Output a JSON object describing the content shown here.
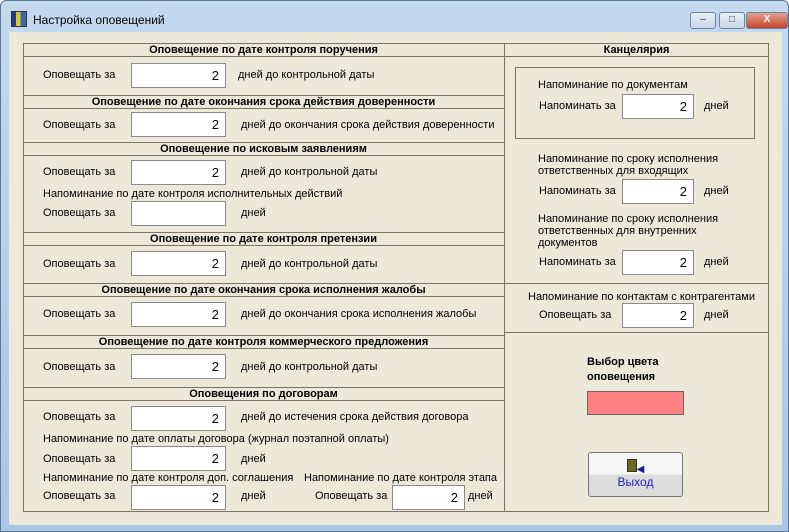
{
  "window": {
    "title": "Настройка оповещений",
    "minimize": "–",
    "maximize": "□",
    "close": "X"
  },
  "left": {
    "s1": {
      "header": "Оповещение по дате контроля поручения",
      "label": "Оповещать за",
      "value": "2",
      "suffix": "дней до контрольной даты"
    },
    "s2": {
      "header": "Оповещение по дате окончания срока действия доверенности",
      "label": "Оповещать за",
      "value": "2",
      "suffix": "дней до окончания срока действия доверенности"
    },
    "s3": {
      "header": "Оповещение по исковым заявлениям",
      "label": "Оповещать за",
      "value": "2",
      "suffix": "дней до контрольной даты",
      "sub": "Напоминание по дате контроля исполнительных действий",
      "label2": "Оповещать за",
      "value2": "",
      "suffix2": "дней"
    },
    "s4": {
      "header": "Оповещение по дате контроля претензии",
      "label": "Оповещать за",
      "value": "2",
      "suffix": "дней до контрольной даты"
    },
    "s5": {
      "header": "Оповещение по дате окончания срока исполнения жалобы",
      "label": "Оповещать за",
      "value": "2",
      "suffix": "дней до окончания срока исполнения жалобы"
    },
    "s6": {
      "header": "Оповещение по дате контроля коммерческого предложения",
      "label": "Оповещать за",
      "value": "2",
      "suffix": "дней до контрольной даты"
    },
    "s7": {
      "header": "Оповещения по договорам",
      "label": "Оповещать за",
      "value": "2",
      "suffix": "дней до истечения срока действия договора",
      "sub1": "Напоминание по дате оплаты договора (журнал поэтапной оплаты)",
      "label1": "Оповещать за",
      "value1": "2",
      "suffix1": "дней",
      "sub2": "Напоминание по дате контроля доп. соглашения",
      "label2": "Оповещать за",
      "value2": "2",
      "suffix2": "дней",
      "sub3": "Напоминание по дате контроля этапа",
      "label3": "Оповещать за",
      "value3": "2",
      "suffix3": "дней"
    }
  },
  "right": {
    "header": "Канцелярия",
    "docs": {
      "title": "Напоминание по документам",
      "label": "Напоминать за",
      "value": "2",
      "suffix": "дней"
    },
    "incoming": {
      "title1": "Напоминание по сроку исполнения",
      "title2": "ответственных для входящих",
      "label": "Напоминать за",
      "value": "2",
      "suffix": "дней"
    },
    "internal": {
      "title1": "Напоминание по сроку исполнения",
      "title2": "ответственных для внутренних",
      "title3": "документов",
      "label": "Напоминать за",
      "value": "2",
      "suffix": "дней"
    },
    "contacts": {
      "title": "Напоминание по контактам с контрагентами",
      "label": "Оповещать за",
      "value": "2",
      "suffix": "дней"
    },
    "color": {
      "title1": "Выбор цвета",
      "title2": "оповещения",
      "value": "#ff8080"
    },
    "exit_label": "Выход"
  }
}
